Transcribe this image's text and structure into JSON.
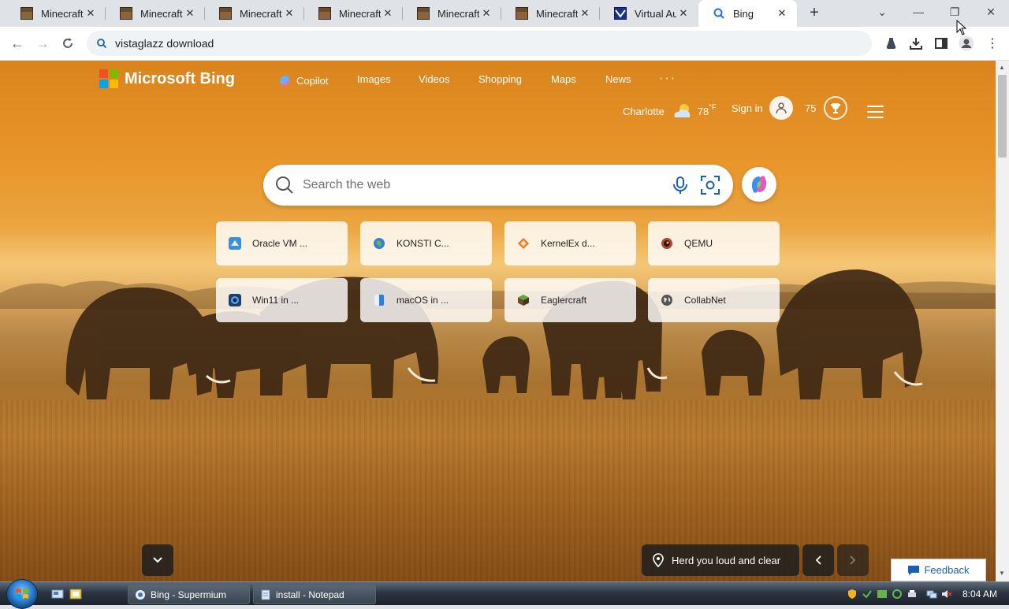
{
  "browser": {
    "tabs": [
      {
        "title": "Minecraft",
        "icon": "minecraft-icon",
        "active": false
      },
      {
        "title": "Minecraft",
        "icon": "minecraft-icon",
        "active": false
      },
      {
        "title": "Minecraft",
        "icon": "minecraft-icon",
        "active": false
      },
      {
        "title": "Minecraft",
        "icon": "minecraft-icon",
        "active": false
      },
      {
        "title": "Minecraft",
        "icon": "minecraft-icon",
        "active": false
      },
      {
        "title": "Minecraft",
        "icon": "minecraft-icon",
        "active": false
      },
      {
        "title": "Virtual Au",
        "icon": "virtual-app-icon",
        "active": false
      },
      {
        "title": "Bing",
        "icon": "search-icon",
        "active": true
      }
    ],
    "address": "vistaglazz download"
  },
  "bing": {
    "logo_text": "Microsoft Bing",
    "nav": {
      "copilot": "Copilot",
      "images": "Images",
      "videos": "Videos",
      "shopping": "Shopping",
      "maps": "Maps",
      "news": "News",
      "more": "···"
    },
    "weather": {
      "city": "Charlotte",
      "temp": "78",
      "unit": "°F"
    },
    "sign_in": "Sign in",
    "rewards_points": "75",
    "search_placeholder": "Search the web",
    "tiles": [
      {
        "label": "Oracle VM ...",
        "icon": "virtualbox-icon",
        "color": "#3d8fd6"
      },
      {
        "label": "KONSTI C...",
        "icon": "globe-icon",
        "color": "#3b7dd8"
      },
      {
        "label": "KernelEx d...",
        "icon": "diamond-icon",
        "color": "#e07a2c"
      },
      {
        "label": "QEMU",
        "icon": "qemu-icon",
        "color": "#b3472a"
      },
      {
        "label": "Win11 in ...",
        "icon": "win11-icon",
        "color": "#1d3f6e"
      },
      {
        "label": "macOS in ...",
        "icon": "macos-icon",
        "color": "#2b7de9"
      },
      {
        "label": "Eaglercraft",
        "icon": "grass-block-icon",
        "color": "#4f8a2b"
      },
      {
        "label": "CollabNet",
        "icon": "globe-icon",
        "color": "#555555"
      }
    ],
    "image_caption": "Herd you loud and clear",
    "feedback": "Feedback"
  },
  "taskbar": {
    "items": [
      {
        "label": "Bing - Supermium",
        "icon": "browser-icon"
      },
      {
        "label": "install - Notepad",
        "icon": "notepad-icon"
      }
    ],
    "clock": "8:04 AM"
  }
}
